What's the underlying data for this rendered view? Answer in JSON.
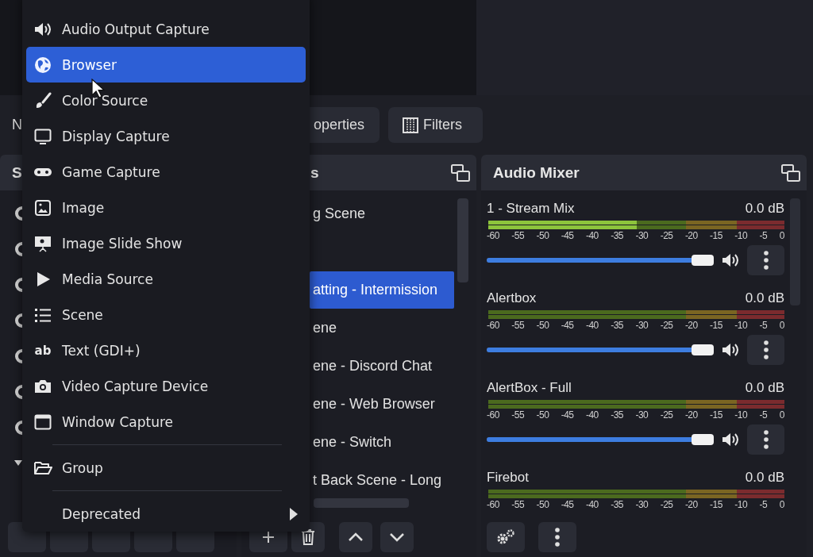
{
  "toolbar": {
    "source_label": "N",
    "buttons": [
      {
        "kind": "properties",
        "label": "operties"
      },
      {
        "kind": "filters",
        "label": "Filters"
      }
    ]
  },
  "scenes_dock": {
    "title": "S"
  },
  "sources_dock": {
    "title": "s",
    "items": [
      {
        "label": "g Scene",
        "selected": false
      },
      {
        "label": "atting - Intermission",
        "selected": true
      },
      {
        "label": "ene",
        "selected": false
      },
      {
        "label": "ene - Discord Chat",
        "selected": false
      },
      {
        "label": "ene - Web Browser",
        "selected": false
      },
      {
        "label": "ene - Switch",
        "selected": false
      },
      {
        "label": "t Back Scene - Long",
        "selected": false
      }
    ]
  },
  "audio_mixer": {
    "title": "Audio Mixer",
    "channels": [
      {
        "kind": "full",
        "name": "1 - Stream Mix",
        "reading": "0.0 dB",
        "meter": {
          "level": 0.5
        },
        "volume": {
          "level": 1
        },
        "scale": [
          "-60",
          "-55",
          "-50",
          "-45",
          "-40",
          "-35",
          "-30",
          "-25",
          "-20",
          "-15",
          "-10",
          "-5",
          "0"
        ]
      },
      {
        "kind": "full",
        "name": "Alertbox",
        "reading": "0.0 dB",
        "volume": {
          "level": 1
        },
        "scale": [
          "-60",
          "-55",
          "-50",
          "-45",
          "-40",
          "-35",
          "-30",
          "-25",
          "-20",
          "-15",
          "-10",
          "-5",
          "0"
        ]
      },
      {
        "kind": "full",
        "name": "AlertBox - Full",
        "reading": "0.0 dB",
        "volume": {
          "level": 1
        },
        "scale": [
          "-60",
          "-55",
          "-50",
          "-45",
          "-40",
          "-35",
          "-30",
          "-25",
          "-20",
          "-15",
          "-10",
          "-5",
          "0"
        ]
      },
      {
        "kind": "meter",
        "name": "Firebot",
        "reading": "0.0 dB",
        "scale": [
          "-60",
          "-55",
          "-50",
          "-45",
          "-40",
          "-35",
          "-30",
          "-25",
          "-20",
          "-15",
          "-10",
          "-5",
          "0"
        ]
      }
    ]
  },
  "context_menu": {
    "items": [
      {
        "kind": "item",
        "label": "Audio Output Capture",
        "selected": false
      },
      {
        "kind": "item",
        "label": "Browser",
        "selected": true
      },
      {
        "kind": "item",
        "label": "Color Source",
        "selected": false
      },
      {
        "kind": "item",
        "label": "Display Capture",
        "selected": false
      },
      {
        "kind": "item",
        "label": "Game Capture",
        "selected": false
      },
      {
        "kind": "item",
        "label": "Image",
        "selected": false
      },
      {
        "kind": "item",
        "label": "Image Slide Show",
        "selected": false
      },
      {
        "kind": "item",
        "label": "Media Source",
        "selected": false
      },
      {
        "kind": "item",
        "label": "Scene",
        "selected": false
      },
      {
        "kind": "item",
        "icon_text": "ab",
        "label": "Text (GDI+)",
        "selected": false
      },
      {
        "kind": "item",
        "label": "Video Capture Device",
        "selected": false
      },
      {
        "kind": "item",
        "label": "Window Capture",
        "selected": false
      },
      {
        "kind": "separator"
      },
      {
        "kind": "item",
        "label": "Group",
        "selected": false
      },
      {
        "kind": "separator"
      },
      {
        "kind": "submenu",
        "label": "Deprecated",
        "selected": false
      }
    ]
  }
}
